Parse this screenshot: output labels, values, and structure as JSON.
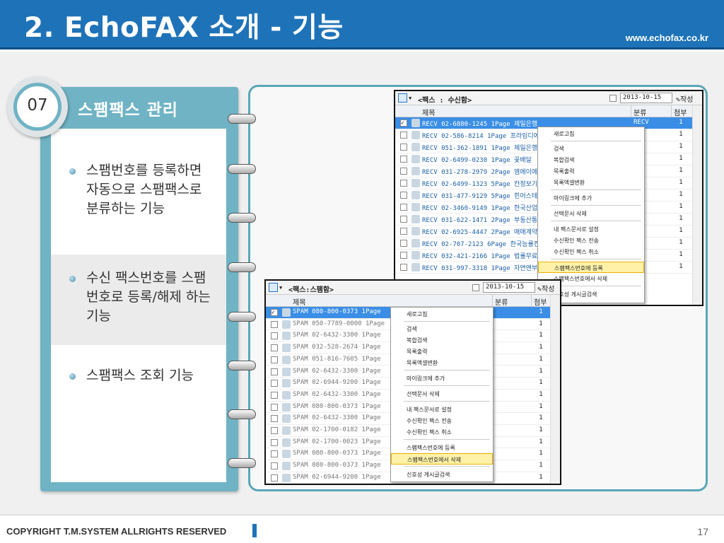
{
  "header": {
    "title": "2. EchoFAX 소개 - 기능",
    "site": "www.echofax.co.kr"
  },
  "panel": {
    "badge": "07",
    "heading": "스팸팩스 관리",
    "items": [
      "스팸번호를 등록하면 자동으로 스팸팩스로 분류하는 기능",
      "수신 팩스번호를 스팸번호로 등록/해제 하는 기능",
      "스팸팩스 조회 기능"
    ]
  },
  "window1": {
    "title": "<팩스 : 수신함>",
    "date": "2013-10-15",
    "write": "작성",
    "columns": [
      "제목",
      "분류",
      "첨부"
    ],
    "rows": [
      {
        "text": "RECV 02-6880-1245 1Page 제일은행",
        "cat": "RECV",
        "att": "1",
        "selected": true
      },
      {
        "text": "RECV 02-586-8214 1Page 프라임디에이",
        "cat": "",
        "att": "1",
        "selected": false
      },
      {
        "text": "RECV 051-362-1891 1Page 제일은행",
        "cat": "",
        "att": "1",
        "selected": false
      },
      {
        "text": "RECV 02-6499-0230 1Page 꽃배달",
        "cat": "",
        "att": "1",
        "selected": false
      },
      {
        "text": "RECV 031-278-2979 2Page 엠에이에스 ",
        "cat": "",
        "att": "1",
        "selected": false
      },
      {
        "text": "RECV 02-6499-1323 5Page 칸정보기술 ",
        "cat": "",
        "att": "1",
        "selected": false
      },
      {
        "text": "RECV 031-477-9129 5Page 힌어스테크볼",
        "cat": "",
        "att": "1",
        "selected": false
      },
      {
        "text": "RECV 02-3460-9149 1Page 한국산업기술",
        "cat": "",
        "att": "1",
        "selected": false
      },
      {
        "text": "RECV 031-622-1471 2Page 부동산통장시",
        "cat": "",
        "att": "1",
        "selected": false
      },
      {
        "text": "RECV 02-6925-4447 2Page 매매계약서",
        "cat": "",
        "att": "1",
        "selected": false
      },
      {
        "text": "RECV 02-707-2123 6Page 한국능률컨설팅",
        "cat": "",
        "att": "1",
        "selected": false
      },
      {
        "text": "RECV 032-421-2166 1Page 법률무료상담",
        "cat": "",
        "att": "1",
        "selected": false
      },
      {
        "text": "RECV 031-997-3318 1Page 자연앤부자미",
        "cat": "",
        "att": "1",
        "selected": false
      }
    ],
    "menu": [
      "새로고침",
      "검색",
      "복합검색",
      "목록출력",
      "목록엑셀변환",
      "마이링크에 추가",
      "선택문서 삭제",
      "내 팩스문서로 설정",
      "수신확인 팩스 전송",
      "수신확인 팩스 취소",
      "스팸팩스번호에 등록",
      "스팸팩스번호에서 삭제",
      "신호성 게시글검색"
    ]
  },
  "window2": {
    "title": "<팩스:스팸함>",
    "date": "2013-10-15",
    "write": "작성",
    "columns": [
      "제목",
      "분류",
      "첨부"
    ],
    "rows": [
      {
        "text": "SPAM 080-800-0373  1Page",
        "att": "1",
        "selected": true
      },
      {
        "text": "SPAM 050-7789-0000  1Page",
        "att": "1",
        "selected": false
      },
      {
        "text": "SPAM 02-6432-3300  1Page",
        "att": "1",
        "selected": false
      },
      {
        "text": "SPAM 032-528-2674  1Page",
        "att": "1",
        "selected": false
      },
      {
        "text": "SPAM 051-816-7605  1Page",
        "att": "1",
        "selected": false
      },
      {
        "text": "SPAM 02-6432-3300  1Page",
        "att": "1",
        "selected": false
      },
      {
        "text": "SPAM 02-6944-9200  1Page",
        "att": "1",
        "selected": false
      },
      {
        "text": "SPAM 02-6432-3300  1Page",
        "att": "1",
        "selected": false
      },
      {
        "text": "SPAM 080-800-0373  1Page",
        "att": "1",
        "selected": false
      },
      {
        "text": "SPAM 02-6432-3300  1Page",
        "att": "1",
        "selected": false
      },
      {
        "text": "SPAM 02-1700-0182  1Page",
        "att": "1",
        "selected": false
      },
      {
        "text": "SPAM 02-1700-0023  1Page",
        "att": "1",
        "selected": false
      },
      {
        "text": "SPAM 080-800-0373  1Page",
        "att": "1",
        "selected": false
      },
      {
        "text": "SPAM 080-800-0373  1Page",
        "att": "1",
        "selected": false
      },
      {
        "text": "SPAM 02-6944-9200  1Page",
        "att": "1",
        "selected": false
      }
    ],
    "menu": [
      "새로고침",
      "검색",
      "복합검색",
      "목록출력",
      "목록엑셀변환",
      "마이링크에 추가",
      "선택문서 삭제",
      "내 팩스문서로 설정",
      "수신확인 팩스 전송",
      "수신확인 팩스 취소",
      "스팸팩스번호에 등록",
      "스팸팩스번호에서 삭제",
      "신호성 게시글검색"
    ]
  },
  "footer": {
    "copyright": "COPYRIGHT T.M.SYSTEM ALLRIGHTS RESERVED",
    "page": "17"
  },
  "colors": {
    "brand": "#1e73b8",
    "panel": "#6fb3c4",
    "selection": "#3a8ee6",
    "highlight": "#fff2a8"
  }
}
